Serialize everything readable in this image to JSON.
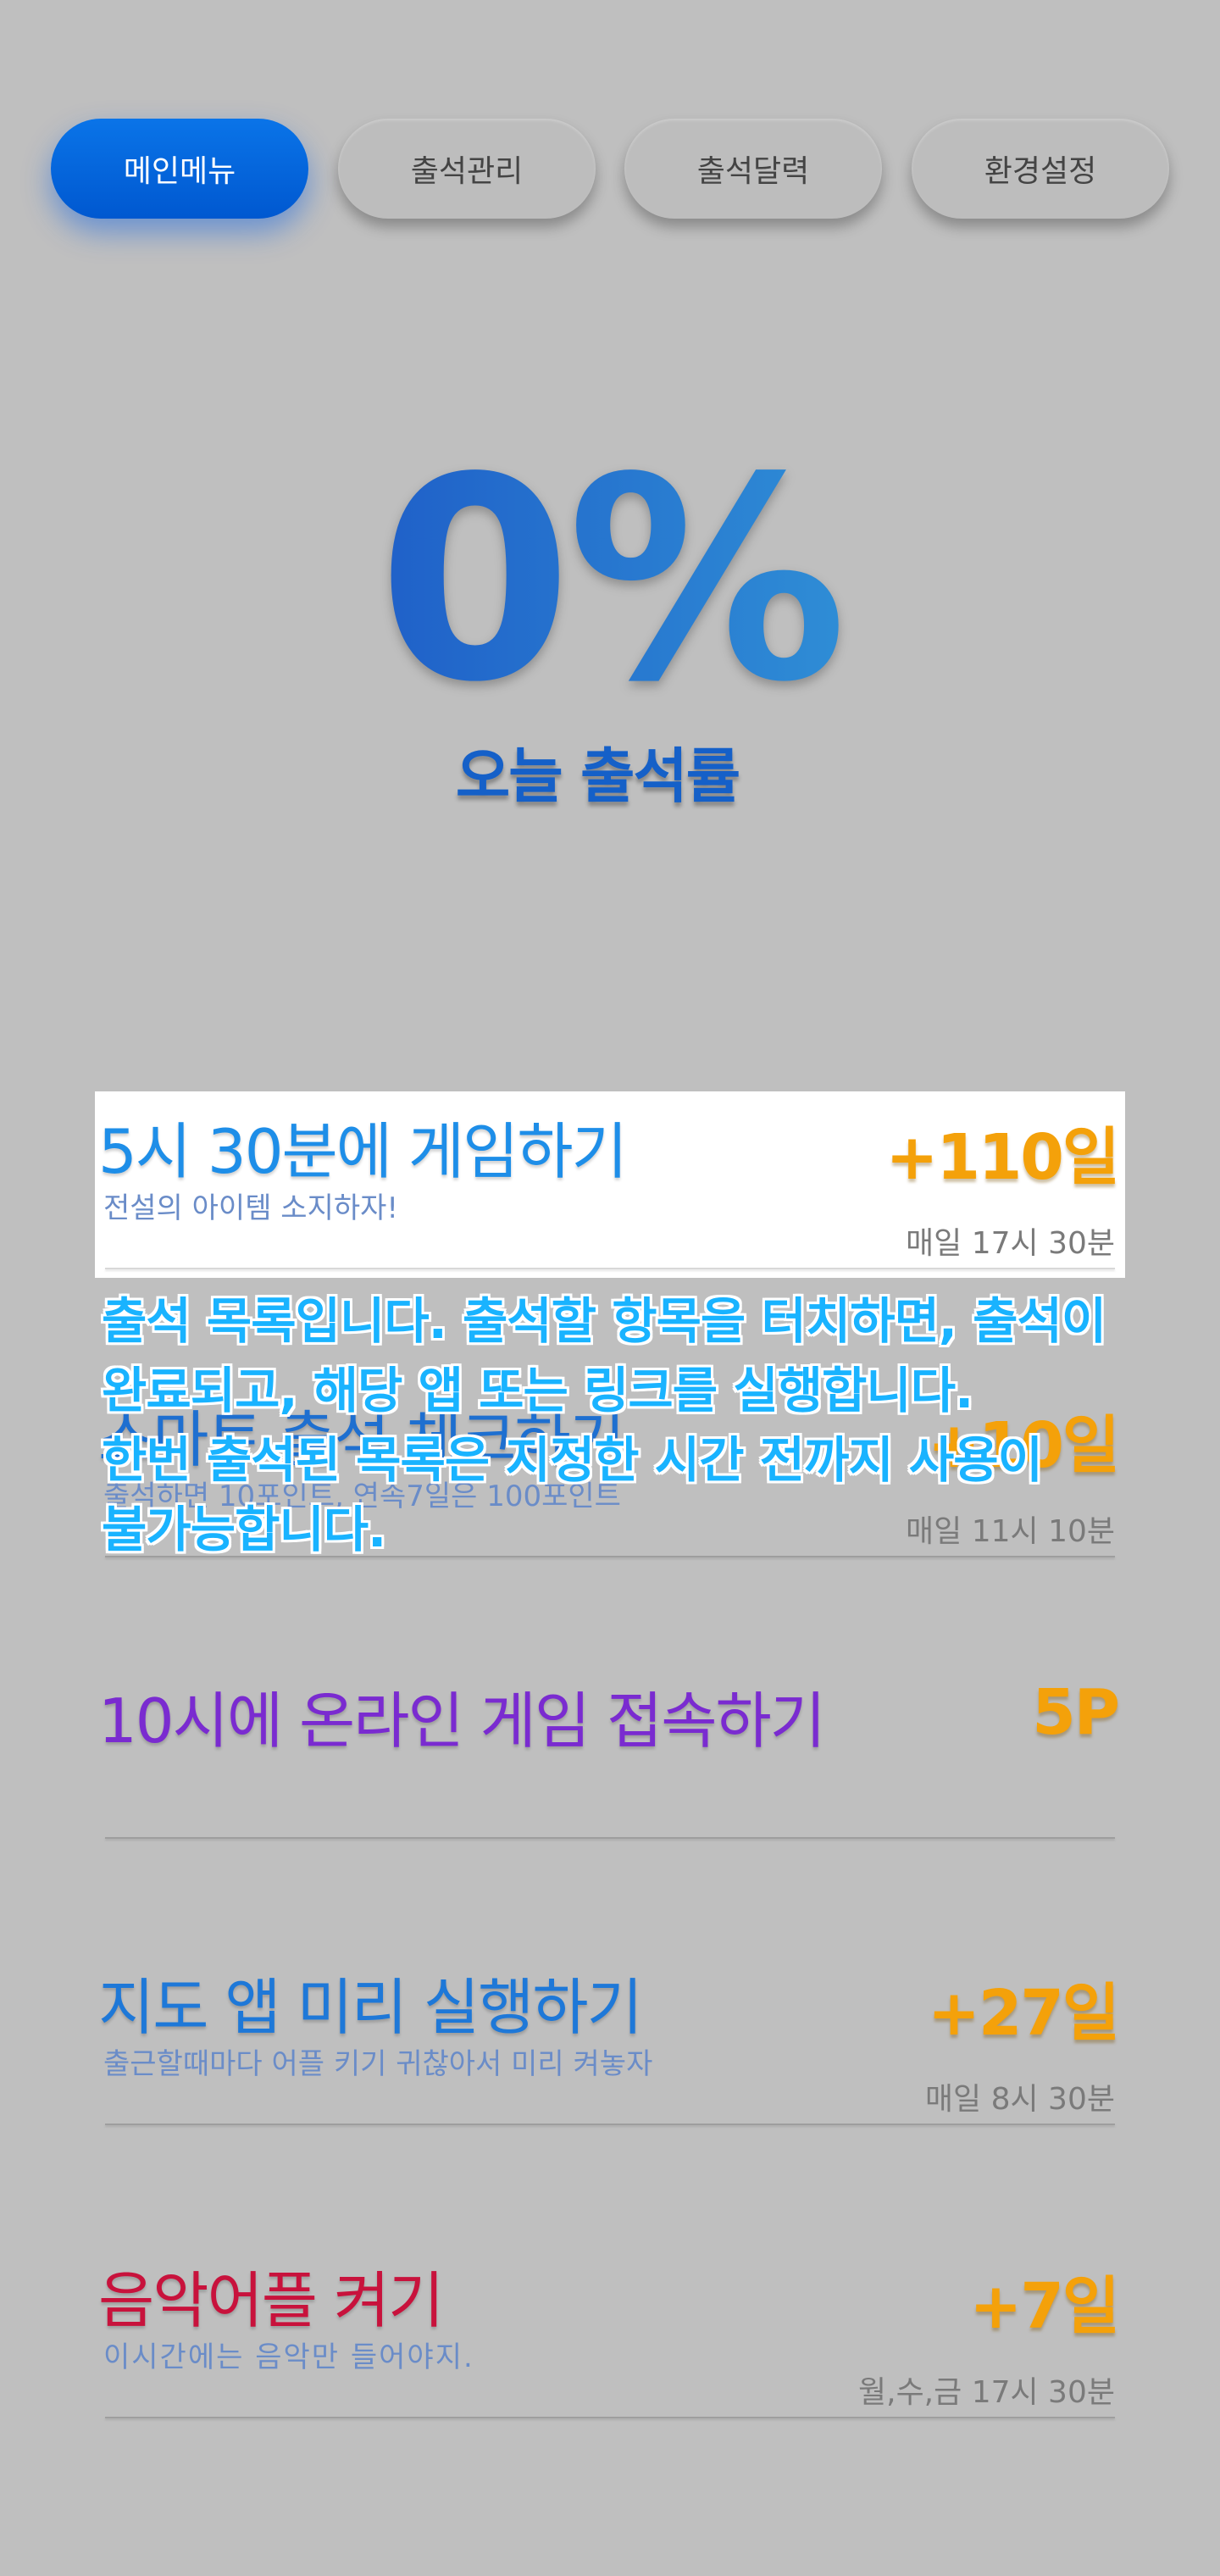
{
  "tabs": [
    {
      "label": "메인메뉴",
      "active": true
    },
    {
      "label": "출석관리",
      "active": false
    },
    {
      "label": "출석달력",
      "active": false
    },
    {
      "label": "환경설정",
      "active": false
    }
  ],
  "rate": {
    "value": "0%",
    "label": "오늘 출석률"
  },
  "items": [
    {
      "title": "5시 30분에 게임하기",
      "subtitle": "전설의 아이템 소지하자!",
      "points": "+110일",
      "schedule": "매일 17시 30분",
      "title_color": "#1e8ee8",
      "highlighted": true
    },
    {
      "title": "스마트 출석 체크하기",
      "subtitle": "출석하면 10포인트, 연속7일은 100포인트",
      "points": "+10일",
      "schedule": "매일 11시 10분",
      "title_color": "#1e6fd0",
      "highlighted": false
    },
    {
      "title": "10시에 온라인 게임 접속하기",
      "subtitle": "",
      "points": "5P",
      "schedule": "",
      "title_color": "#7a2bd0",
      "highlighted": false
    },
    {
      "title": "지도 앱 미리 실행하기",
      "subtitle": "출근할때마다 어플 키기 귀찮아서 미리 켜놓자",
      "points": "+27일",
      "schedule": "매일 8시 30분",
      "title_color": "#1e78d8",
      "highlighted": false
    },
    {
      "title": "음악어플 켜기",
      "subtitle": "이시간에는 음악만 들어야지.",
      "points": "+7일",
      "schedule": "월,수,금 17시 30분",
      "title_color": "#c8123c",
      "highlighted": false
    }
  ],
  "overlay": {
    "lines": [
      "출석 목록입니다. 출석할 항목을 터치하면, 출석이",
      "완료되고, 해당 앱 또는 링크를 실행합니다.",
      "한번 출석된 목록은 지정한 시간 전까지 사용이",
      "불가능합니다."
    ]
  }
}
